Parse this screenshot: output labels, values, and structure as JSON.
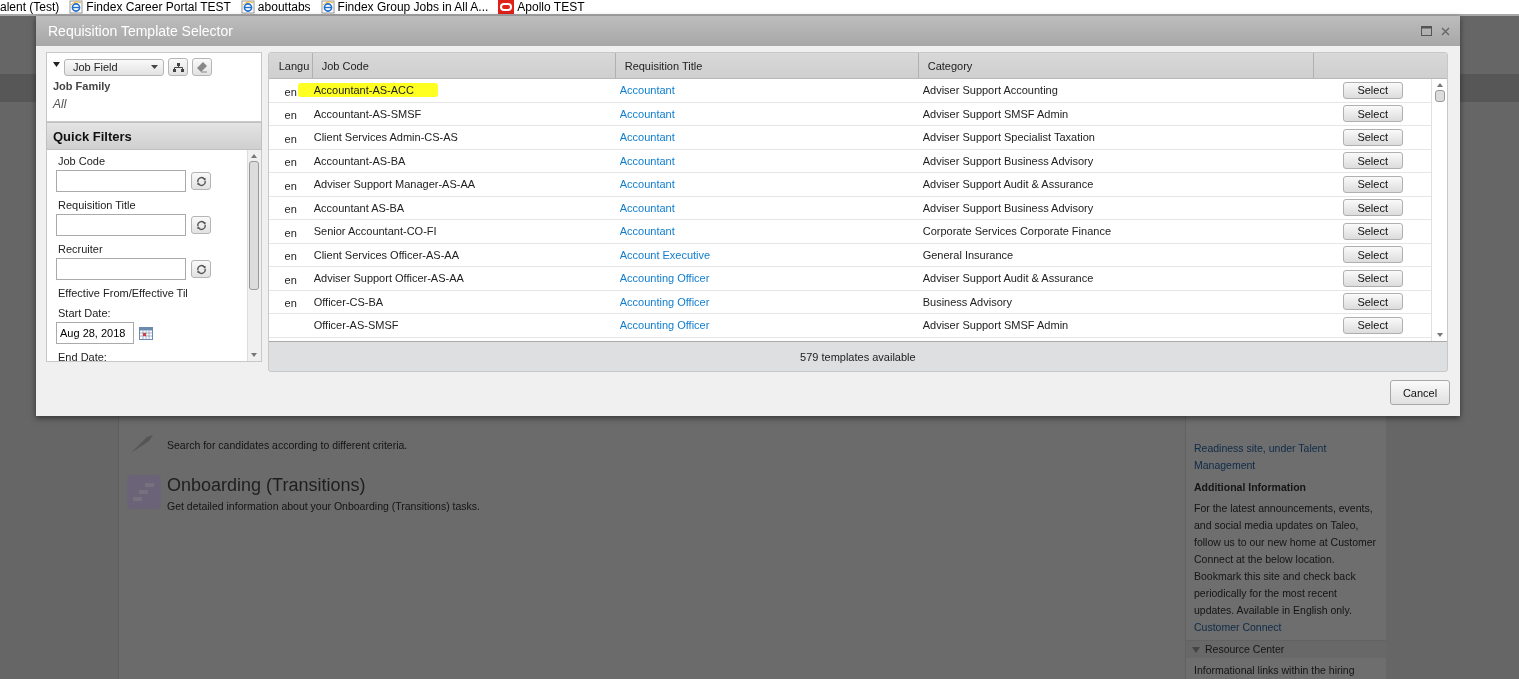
{
  "bookmarks": [
    {
      "label": "alent (Test)",
      "kind": "plain"
    },
    {
      "label": "Findex Career Portal TEST",
      "kind": "ie"
    },
    {
      "label": "abouttabs",
      "kind": "ie"
    },
    {
      "label": "Findex Group Jobs in All A...",
      "kind": "ie"
    },
    {
      "label": "Apollo TEST",
      "kind": "oracle"
    }
  ],
  "background_page": {
    "items": [
      {
        "kind": "search",
        "description": "Search for candidates according to different criteria."
      },
      {
        "kind": "onboarding",
        "title": "Onboarding (Transitions)",
        "description": "Get detailed information about your Onboarding (Transitions) tasks."
      }
    ],
    "sidebar": {
      "link": "Readiness site, under Talent Management",
      "heading": "Additional Information",
      "paragraph": "For the latest announcements, events, and social media updates on Taleo, follow us to our new home at Customer Connect at the below location. Bookmark this site and check back periodically for the most recent updates. Available in English only.",
      "link_2": "Customer Connect",
      "section": {
        "title": "Resource Center",
        "expanded": true,
        "text": "Informational links within the hiring"
      }
    }
  },
  "dialog": {
    "title": "Requisition Template Selector",
    "tree": {
      "dropdown": "Job Field",
      "label": "Job Family",
      "value": "All"
    },
    "quick_filters": {
      "title": "Quick Filters",
      "fields": [
        {
          "kind": "text",
          "label": "Job Code"
        },
        {
          "kind": "text",
          "label": "Requisition Title"
        },
        {
          "kind": "text",
          "label": "Recruiter"
        },
        {
          "kind": "label",
          "label": "Effective From/Effective Til"
        },
        {
          "kind": "date",
          "label": "Start Date:",
          "value": "Aug 28, 2018"
        },
        {
          "kind": "label",
          "label": "End Date:"
        }
      ]
    },
    "table": {
      "columns": [
        "Langu",
        "Job Code",
        "Requisition Title",
        "Category"
      ],
      "rows": [
        {
          "language": "en",
          "job_code": "Accountant-AS-ACC",
          "title": "Accountant",
          "category": "Adviser Support Accounting",
          "action": "Select",
          "highlighted": true
        },
        {
          "language": "en",
          "job_code": "Accountant-AS-SMSF",
          "title": "Accountant",
          "category": "Adviser Support SMSF Admin",
          "action": "Select",
          "highlighted": false
        },
        {
          "language": "en",
          "job_code": "Client Services Admin-CS-AS",
          "title": "Accountant",
          "category": "Adviser Support Specialist Taxation",
          "action": "Select",
          "highlighted": false
        },
        {
          "language": "en",
          "job_code": "Accountant-AS-BA",
          "title": "Accountant",
          "category": "Adviser Support Business Advisory",
          "action": "Select",
          "highlighted": false
        },
        {
          "language": "en",
          "job_code": "Adviser Support Manager-AS-AA",
          "title": "Accountant",
          "category": "Adviser Support Audit & Assurance",
          "action": "Select",
          "highlighted": false
        },
        {
          "language": "en",
          "job_code": "Accountant AS-BA",
          "title": "Accountant",
          "category": "Adviser Support Business Advisory",
          "action": "Select",
          "highlighted": false
        },
        {
          "language": "en",
          "job_code": "Senior Accountant-CO-FI",
          "title": "Accountant",
          "category": "Corporate Services Corporate Finance",
          "action": "Select",
          "highlighted": false
        },
        {
          "language": "en",
          "job_code": "Client Services Officer-AS-AA",
          "title": "Account Executive",
          "category": "General Insurance",
          "action": "Select",
          "highlighted": false
        },
        {
          "language": "en",
          "job_code": "Adviser Support Officer-AS-AA",
          "title": "Accounting Officer",
          "category": "Adviser Support Audit & Assurance",
          "action": "Select",
          "highlighted": false
        },
        {
          "language": "en",
          "job_code": "Officer-CS-BA",
          "title": "Accounting Officer",
          "category": "Business Advisory",
          "action": "Select",
          "highlighted": false
        },
        {
          "job_code": "Officer-AS-SMSF",
          "title": "Accounting Officer",
          "category": "Adviser Support SMSF Admin",
          "action": "Select",
          "highlighted": false
        }
      ],
      "footer": "579 templates available"
    },
    "cancel": "Cancel"
  }
}
